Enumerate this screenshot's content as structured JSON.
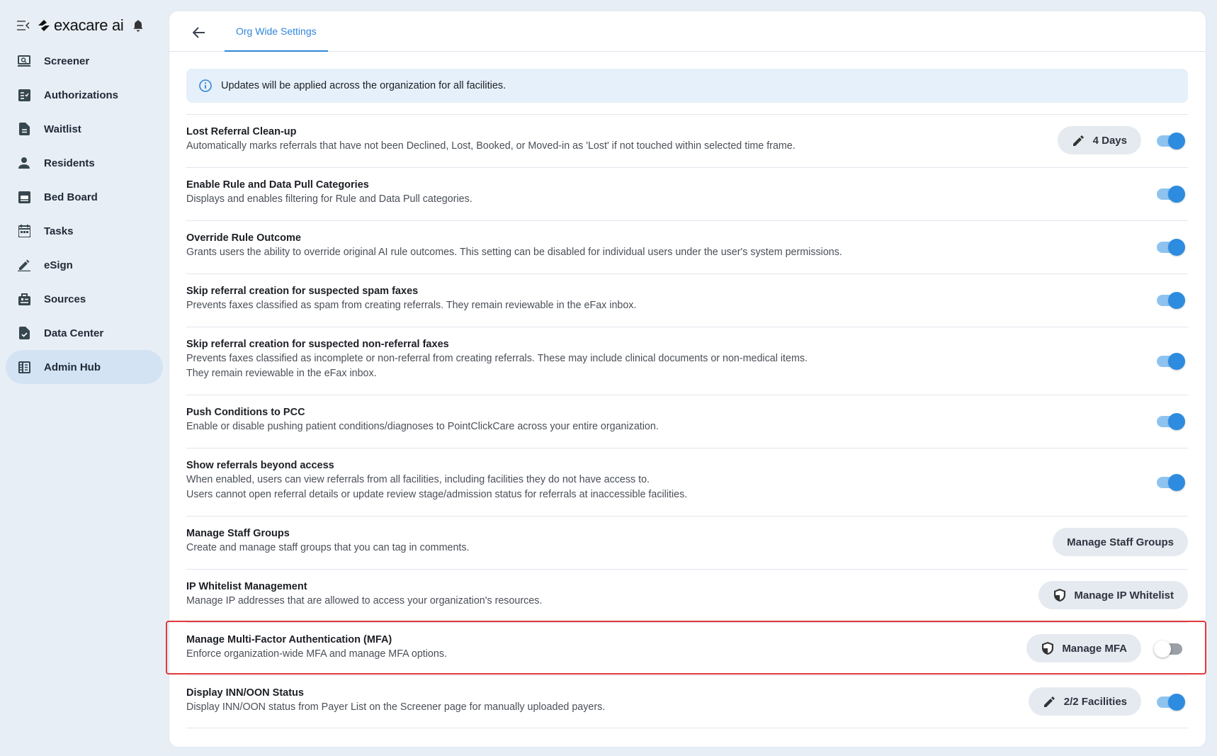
{
  "brand": {
    "name": "exacare ai"
  },
  "nav": {
    "items": [
      {
        "label": "Screener",
        "icon": "screener-icon"
      },
      {
        "label": "Authorizations",
        "icon": "authorizations-icon"
      },
      {
        "label": "Waitlist",
        "icon": "waitlist-icon"
      },
      {
        "label": "Residents",
        "icon": "person-icon"
      },
      {
        "label": "Bed Board",
        "icon": "bed-board-icon"
      },
      {
        "label": "Tasks",
        "icon": "calendar-icon"
      },
      {
        "label": "eSign",
        "icon": "pen-icon"
      },
      {
        "label": "Sources",
        "icon": "sources-icon"
      },
      {
        "label": "Data Center",
        "icon": "data-center-icon"
      },
      {
        "label": "Admin Hub",
        "icon": "admin-hub-icon",
        "active": true
      }
    ]
  },
  "header": {
    "tab": "Org Wide Settings"
  },
  "banner": {
    "text": "Updates will be applied across the organization for all facilities."
  },
  "settings": [
    {
      "title": "Lost Referral Clean-up",
      "desc": [
        "Automatically marks referrals that have not been Declined, Lost, Booked, or Moved-in as 'Lost' if not touched within selected time frame."
      ],
      "button": "4 Days",
      "toggle": true
    },
    {
      "title": "Enable Rule and Data Pull Categories",
      "desc": [
        "Displays and enables filtering for Rule and Data Pull categories."
      ],
      "toggle": true
    },
    {
      "title": "Override Rule Outcome",
      "desc": [
        "Grants users the ability to override original AI rule outcomes. This setting can be disabled for individual users under the user's system permissions."
      ],
      "toggle": true
    },
    {
      "title": "Skip referral creation for suspected spam faxes",
      "desc": [
        "Prevents faxes classified as spam from creating referrals. They remain reviewable in the eFax inbox."
      ],
      "toggle": true
    },
    {
      "title": "Skip referral creation for suspected non-referral faxes",
      "desc": [
        "Prevents faxes classified as incomplete or non-referral from creating referrals. These may include clinical documents or non-medical items.",
        "They remain reviewable in the eFax inbox."
      ],
      "toggle": true
    },
    {
      "title": "Push Conditions to PCC",
      "desc": [
        "Enable or disable pushing patient conditions/diagnoses to PointClickCare across your entire organization."
      ],
      "toggle": true
    },
    {
      "title": "Show referrals beyond access",
      "desc": [
        "When enabled, users can view referrals from all facilities, including facilities they do not have access to.",
        "Users cannot open referral details or update review stage/admission status for referrals at inaccessible facilities."
      ],
      "toggle": true
    },
    {
      "title": "Manage Staff Groups",
      "desc": [
        "Create and manage staff groups that you can tag in comments."
      ],
      "button": "Manage Staff Groups"
    },
    {
      "title": "IP Whitelist Management",
      "desc": [
        "Manage IP addresses that are allowed to access your organization's resources."
      ],
      "button": "Manage IP Whitelist"
    },
    {
      "title": "Manage Multi-Factor Authentication (MFA)",
      "desc": [
        "Enforce organization-wide MFA and manage MFA options."
      ],
      "button": "Manage MFA",
      "toggle": false
    },
    {
      "title": "Display INN/OON Status",
      "desc": [
        "Display INN/OON status from Payer List on the Screener page for manually uploaded payers."
      ],
      "button": "2/2 Facilities",
      "toggle": true
    }
  ],
  "colors": {
    "accent": "#2f86d9",
    "highlight": "#e03a3a",
    "activeNav": "#d4e3f3"
  }
}
